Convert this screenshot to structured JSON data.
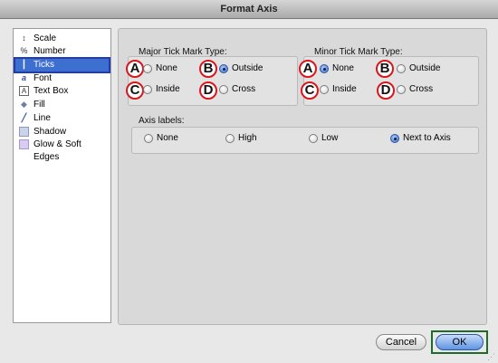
{
  "window": {
    "title": "Format Axis"
  },
  "sidebar": {
    "items": [
      {
        "label": "Scale",
        "icon": "scale-icon",
        "glyph": "↕",
        "selected": false
      },
      {
        "label": "Number",
        "icon": "number-icon",
        "glyph": "%",
        "selected": false
      },
      {
        "label": "Ticks",
        "icon": "ticks-icon",
        "glyph": "┃",
        "selected": true
      },
      {
        "label": "Font",
        "icon": "font-icon",
        "glyph": "a",
        "selected": false
      },
      {
        "label": "Text Box",
        "icon": "textbox-icon",
        "glyph": "A",
        "selected": false
      },
      {
        "label": "Fill",
        "icon": "paint-bucket-icon",
        "glyph": "◆",
        "selected": false
      },
      {
        "label": "Line",
        "icon": "line-icon",
        "glyph": "╱",
        "selected": false
      },
      {
        "label": "Shadow",
        "icon": "shadow-icon",
        "glyph": "▢",
        "selected": false
      },
      {
        "label": "Glow & Soft Edges",
        "icon": "glow-icon",
        "glyph": "▢",
        "selected": false
      }
    ]
  },
  "major": {
    "title": "Major Tick Mark Type:",
    "options": [
      {
        "badge": "A",
        "label": "None",
        "selected": false
      },
      {
        "badge": "B",
        "label": "Outside",
        "selected": true
      },
      {
        "badge": "C",
        "label": "Inside",
        "selected": false
      },
      {
        "badge": "D",
        "label": "Cross",
        "selected": false
      }
    ]
  },
  "minor": {
    "title": "Minor Tick Mark Type:",
    "options": [
      {
        "badge": "A",
        "label": "None",
        "selected": true
      },
      {
        "badge": "B",
        "label": "Outside",
        "selected": false
      },
      {
        "badge": "C",
        "label": "Inside",
        "selected": false
      },
      {
        "badge": "D",
        "label": "Cross",
        "selected": false
      }
    ]
  },
  "axis_labels": {
    "title": "Axis labels:",
    "options": [
      {
        "label": "None",
        "selected": false
      },
      {
        "label": "High",
        "selected": false
      },
      {
        "label": "Low",
        "selected": false
      },
      {
        "label": "Next to Axis",
        "selected": true
      }
    ]
  },
  "buttons": {
    "cancel": "Cancel",
    "ok": "OK"
  },
  "colors": {
    "selection": "#3d6fd1",
    "badge_ring": "#d8171d",
    "ok_highlight": "#1e6b2c"
  }
}
